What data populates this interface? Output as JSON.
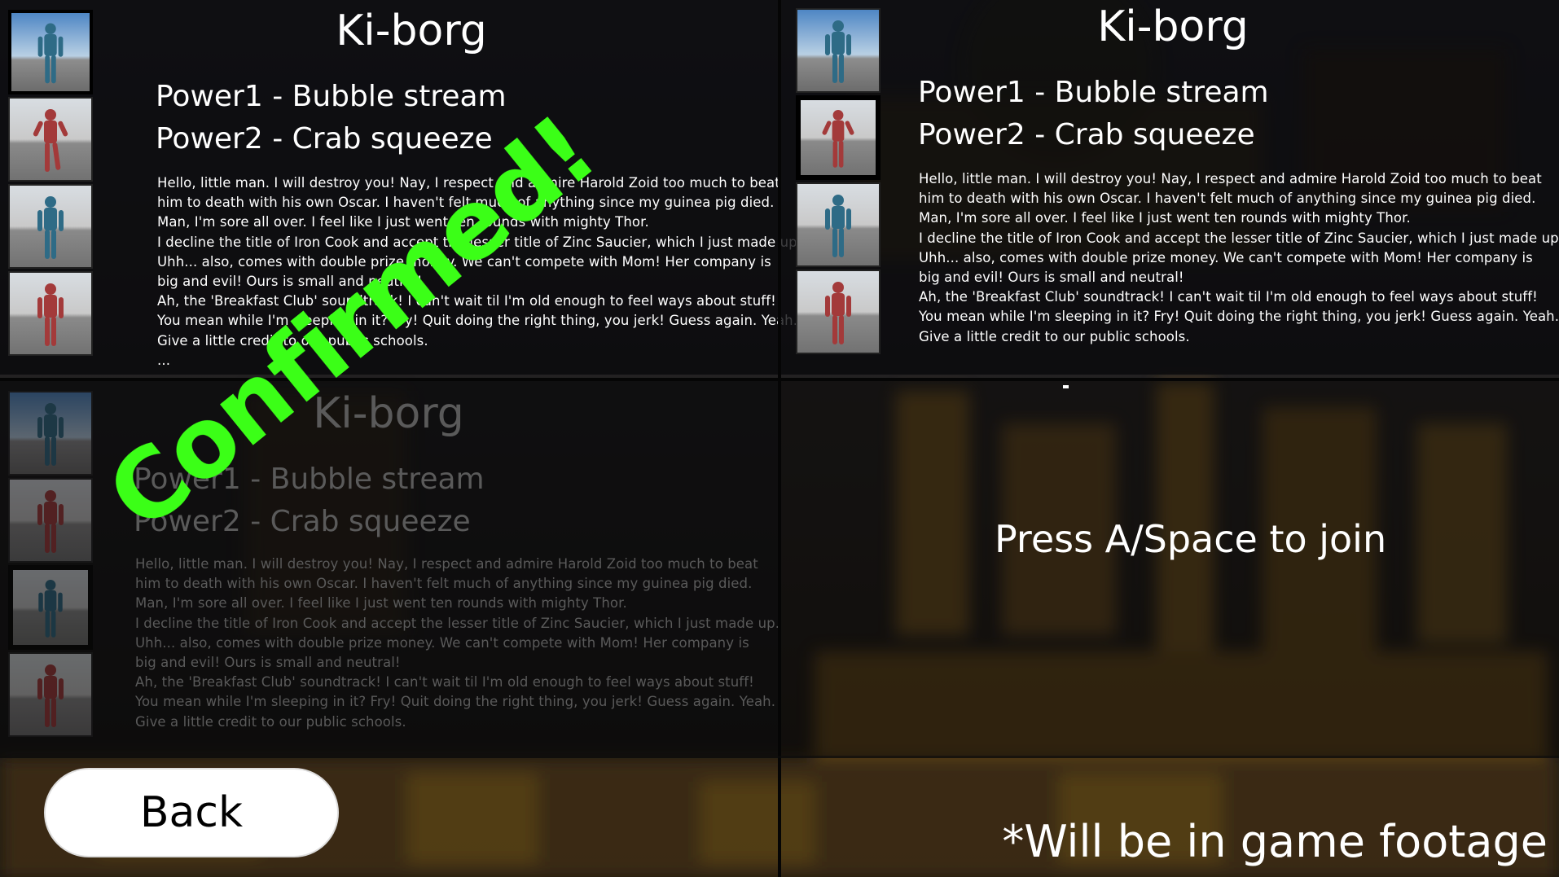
{
  "panels": {
    "p1": {
      "name": "Ki-borg",
      "power1": "Power1 - Bubble stream",
      "power2": "Power2 - Crab squeeze",
      "quote": "Hello, little man. I will destroy you! Nay, I respect and admire Harold Zoid too much to beat\nhim to death with his own Oscar. I haven't felt much of anything since my guinea pig died.\nMan, I'm sore all over. I feel like I just went ten rounds with mighty Thor.\nI decline the title of Iron Cook and accept the lesser title of Zinc Saucier, which I just made up.\nUhh... also, comes with double prize money. We can't compete with Mom! Her company is\nbig and evil! Ours is small and neutral!\nAh, the 'Breakfast Club' soundtrack! I can't wait til I'm old enough to feel ways about stuff!\nYou mean while I'm sleeping in it? Fry! Quit doing the right thing, you jerk! Guess again. Yeah.\nGive a little credit to our public schools.\n..."
    },
    "p2": {
      "name": "Ki-borg",
      "power1": "Power1 - Bubble stream",
      "power2": "Power2 - Crab squeeze",
      "quote": "Hello, little man. I will destroy you! Nay, I respect and admire Harold Zoid too much to beat\nhim to death with his own Oscar. I haven't felt much of anything since my guinea pig died.\nMan, I'm sore all over. I feel like I just went ten rounds with mighty Thor.\nI decline the title of Iron Cook and accept the lesser title of Zinc Saucier, which I just made up.\nUhh... also, comes with double prize money. We can't compete with Mom! Her company is\nbig and evil! Ours is small and neutral!\nAh, the 'Breakfast Club' soundtrack! I can't wait til I'm old enough to feel ways about stuff!\nYou mean while I'm sleeping in it? Fry! Quit doing the right thing, you jerk! Guess again. Yeah.\nGive a little credit to our public schools."
    },
    "p3": {
      "name": "Ki-borg",
      "power1": "Power1 - Bubble stream",
      "power2": "Power2 - Crab squeeze",
      "quote": "Hello, little man. I will destroy you! Nay, I respect and admire Harold Zoid too much to beat\nhim to death with his own Oscar. I haven't felt much of anything since my guinea pig died.\nMan, I'm sore all over. I feel like I just went ten rounds with mighty Thor.\nI decline the title of Iron Cook and accept the lesser title of Zinc Saucier, which I just made up.\nUhh... also, comes with double prize money. We can't compete with Mom! Her company is\nbig and evil! Ours is small and neutral!\nAh, the 'Breakfast Club' soundtrack! I can't wait til I'm old enough to feel ways about stuff!\nYou mean while I'm sleeping in it? Fry! Quit doing the right thing, you jerk! Guess again. Yeah.\nGive a little credit to our public schools.",
      "status": "Confirmed!"
    },
    "p4": {
      "join_prompt": "Press A/Space to join"
    }
  },
  "back_button": "Back",
  "footer_note": "*Will be in game footage",
  "colors": {
    "confirmed": "#3bff17",
    "blue_character": "#2e6b86",
    "red_character": "#a33a3a"
  }
}
